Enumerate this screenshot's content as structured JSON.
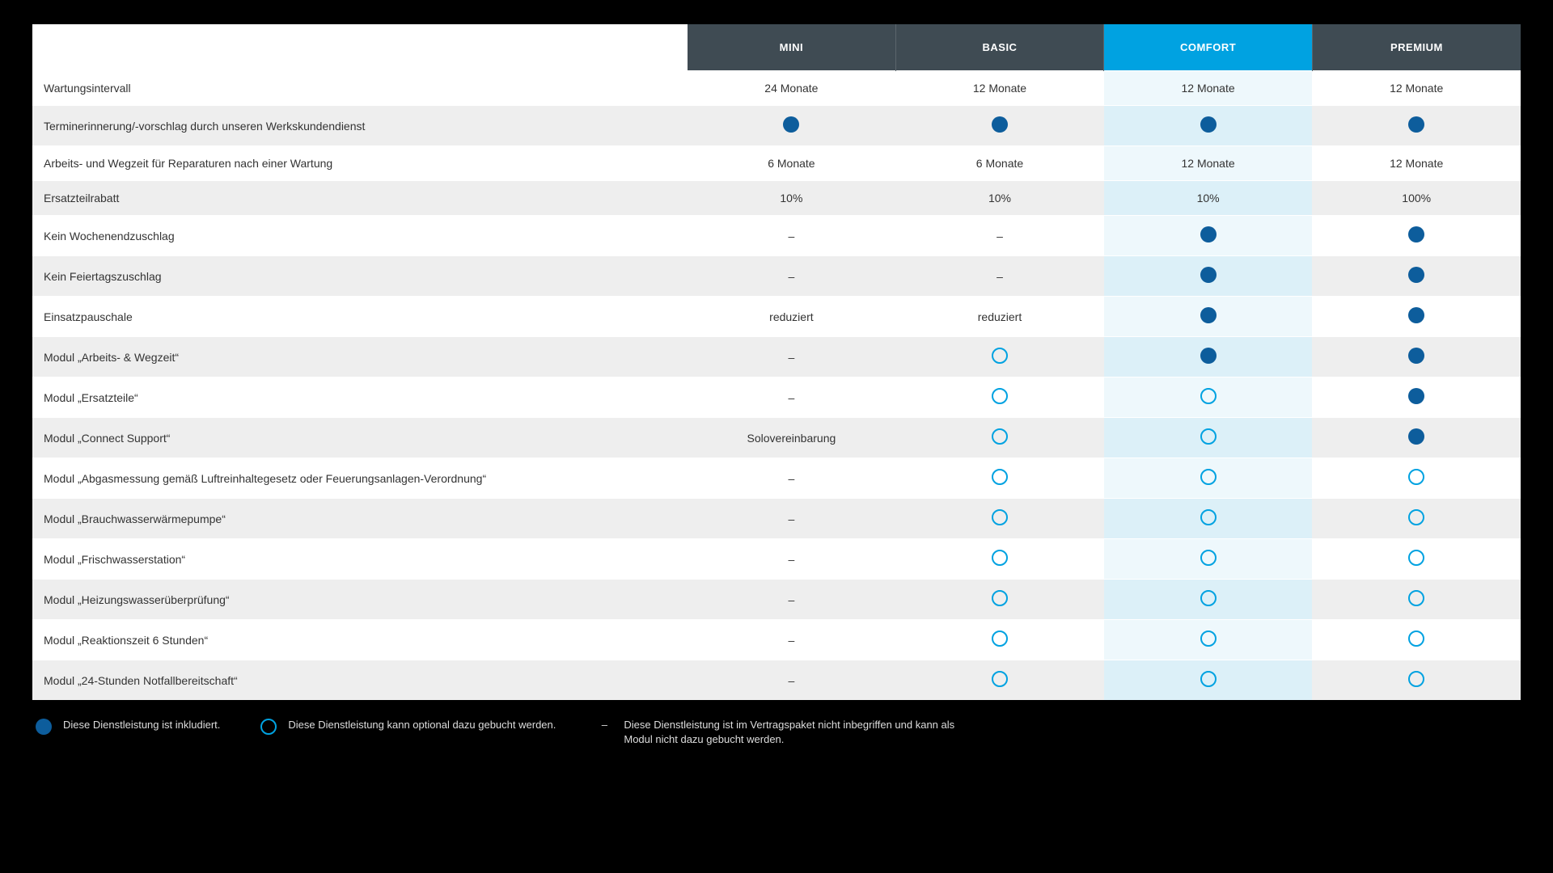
{
  "plans": [
    "MINI",
    "BASIC",
    "COMFORT",
    "PREMIUM"
  ],
  "highlight_index": 2,
  "rows": [
    {
      "label": "Wartungsintervall",
      "cells": [
        {
          "type": "text",
          "value": "24 Monate"
        },
        {
          "type": "text",
          "value": "12 Monate"
        },
        {
          "type": "text",
          "value": "12 Monate"
        },
        {
          "type": "text",
          "value": "12 Monate"
        }
      ]
    },
    {
      "label": "Terminerinnerung/-vorschlag durch unseren Werkskundendienst",
      "cells": [
        {
          "type": "filled"
        },
        {
          "type": "filled"
        },
        {
          "type": "filled"
        },
        {
          "type": "filled"
        }
      ]
    },
    {
      "label": "Arbeits- und Wegzeit für Reparaturen nach einer Wartung",
      "cells": [
        {
          "type": "text",
          "value": "6 Monate"
        },
        {
          "type": "text",
          "value": "6 Monate"
        },
        {
          "type": "text",
          "value": "12 Monate"
        },
        {
          "type": "text",
          "value": "12 Monate"
        }
      ]
    },
    {
      "label": "Ersatzteilrabatt",
      "cells": [
        {
          "type": "text",
          "value": "10%"
        },
        {
          "type": "text",
          "value": "10%"
        },
        {
          "type": "text",
          "value": "10%"
        },
        {
          "type": "text",
          "value": "100%"
        }
      ]
    },
    {
      "label": "Kein Wochenendzuschlag",
      "cells": [
        {
          "type": "dash"
        },
        {
          "type": "dash"
        },
        {
          "type": "filled"
        },
        {
          "type": "filled"
        }
      ]
    },
    {
      "label": "Kein Feiertagszuschlag",
      "cells": [
        {
          "type": "dash"
        },
        {
          "type": "dash"
        },
        {
          "type": "filled"
        },
        {
          "type": "filled"
        }
      ]
    },
    {
      "label": "Einsatzpauschale",
      "cells": [
        {
          "type": "text",
          "value": "reduziert"
        },
        {
          "type": "text",
          "value": "reduziert"
        },
        {
          "type": "filled"
        },
        {
          "type": "filled"
        }
      ]
    },
    {
      "label": "Modul „Arbeits- & Wegzeit“",
      "cells": [
        {
          "type": "dash"
        },
        {
          "type": "outline"
        },
        {
          "type": "filled"
        },
        {
          "type": "filled"
        }
      ]
    },
    {
      "label": "Modul „Ersatzteile“",
      "cells": [
        {
          "type": "dash"
        },
        {
          "type": "outline"
        },
        {
          "type": "outline"
        },
        {
          "type": "filled"
        }
      ]
    },
    {
      "label": "Modul „Connect Support“",
      "cells": [
        {
          "type": "text",
          "value": "Solovereinbarung"
        },
        {
          "type": "outline"
        },
        {
          "type": "outline"
        },
        {
          "type": "filled"
        }
      ]
    },
    {
      "label": "Modul „Abgasmessung gemäß Luftreinhaltegesetz oder Feuerungsanlagen-Verordnung“",
      "cells": [
        {
          "type": "dash"
        },
        {
          "type": "outline"
        },
        {
          "type": "outline"
        },
        {
          "type": "outline"
        }
      ]
    },
    {
      "label": "Modul „Brauchwasserwärmepumpe“",
      "cells": [
        {
          "type": "dash"
        },
        {
          "type": "outline"
        },
        {
          "type": "outline"
        },
        {
          "type": "outline"
        }
      ]
    },
    {
      "label": "Modul „Frischwasserstation“",
      "cells": [
        {
          "type": "dash"
        },
        {
          "type": "outline"
        },
        {
          "type": "outline"
        },
        {
          "type": "outline"
        }
      ]
    },
    {
      "label": "Modul „Heizungswasserüberprüfung“",
      "cells": [
        {
          "type": "dash"
        },
        {
          "type": "outline"
        },
        {
          "type": "outline"
        },
        {
          "type": "outline"
        }
      ]
    },
    {
      "label": "Modul „Reaktionszeit 6 Stunden“",
      "cells": [
        {
          "type": "dash"
        },
        {
          "type": "outline"
        },
        {
          "type": "outline"
        },
        {
          "type": "outline"
        }
      ]
    },
    {
      "label": "Modul „24-Stunden Notfallbereitschaft“",
      "cells": [
        {
          "type": "dash"
        },
        {
          "type": "outline"
        },
        {
          "type": "outline"
        },
        {
          "type": "outline"
        }
      ]
    }
  ],
  "legend": {
    "included": "Diese Dienstleistung ist inkludiert.",
    "optional": "Diese Dienstleistung kann optional dazu gebucht werden.",
    "excluded": "Diese Dienstleistung ist im Vertragspaket nicht inbegriffen und kann als Modul nicht dazu gebucht werden."
  }
}
